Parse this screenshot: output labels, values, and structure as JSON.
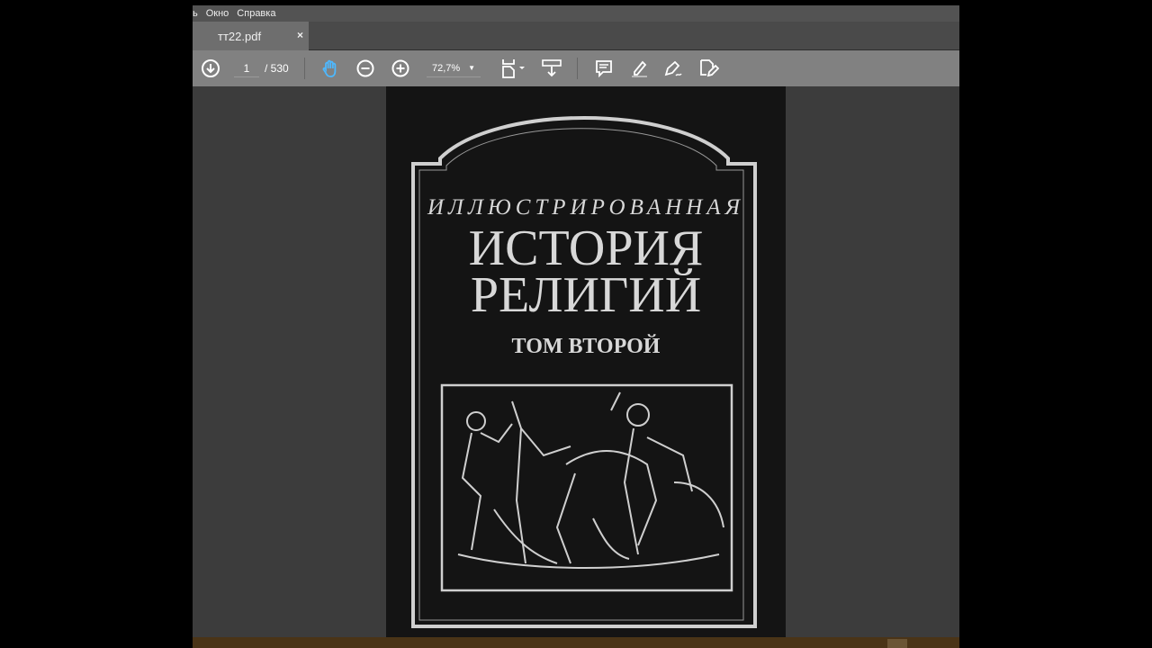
{
  "menu": {
    "items": [
      "ь",
      "Окно",
      "Справка"
    ]
  },
  "tab": {
    "title": "тт22.pdf",
    "close": "×"
  },
  "toolbar": {
    "page_current": "1",
    "page_total": "/ 530",
    "zoom": "72,7%"
  },
  "document": {
    "cover": {
      "line1": "ИЛЛЮСТРИРОВАННАЯ",
      "line2": "ИСТОРИЯ",
      "line3": "РЕЛИГИЙ",
      "line4": "ТОМ ВТОРОЙ"
    }
  },
  "colors": {
    "accent": "#4db8ff",
    "toolbar": "#818181",
    "cover_text": "#d8d8d8"
  }
}
